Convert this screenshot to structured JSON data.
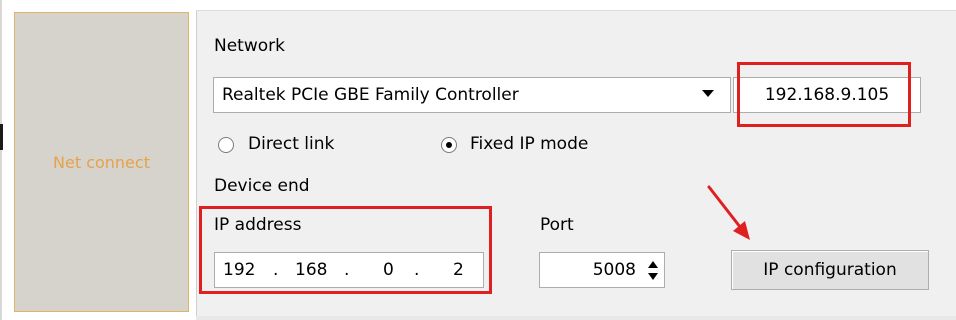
{
  "nav": {
    "tab_label": "Net connect"
  },
  "network": {
    "label": "Network",
    "adapter_selected": "Realtek PCIe GBE Family Controller",
    "local_ip": "192.168.9.105"
  },
  "mode": {
    "direct_link_label": "Direct link",
    "fixed_ip_label": "Fixed IP mode",
    "selected": "Fixed IP mode"
  },
  "device": {
    "section_label": "Device end",
    "ip_label": "IP address",
    "ip_octets": [
      "192",
      "168",
      "0",
      "2"
    ],
    "port_label": "Port",
    "port_value": "5008",
    "config_button_label": "IP configuration"
  },
  "colors": {
    "highlight": "#e02020",
    "tab_text": "#e6a24a",
    "tab_border": "#e3b36a"
  },
  "icons": [
    "dropdown-arrow-icon",
    "spin-up-icon",
    "spin-down-icon",
    "radio-icon",
    "arrow-annotation-icon"
  ]
}
